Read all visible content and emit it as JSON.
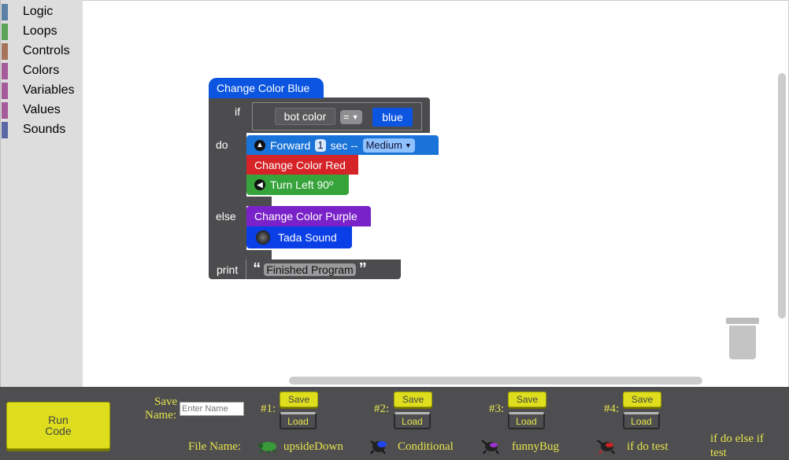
{
  "toolbox": {
    "categories": [
      {
        "label": "Logic",
        "color": "#5b80a5"
      },
      {
        "label": "Loops",
        "color": "#5ba55b"
      },
      {
        "label": "Controls",
        "color": "#a5745b"
      },
      {
        "label": "Colors",
        "color": "#a55b99"
      },
      {
        "label": "Variables",
        "color": "#a55b99"
      },
      {
        "label": "Values",
        "color": "#a55b99"
      },
      {
        "label": "Sounds",
        "color": "#5b67a5"
      }
    ]
  },
  "blocks": {
    "hat_label": "Change Color Blue",
    "if_label": "if",
    "bot_color_label": "bot color",
    "op_label": "=",
    "blue_label": "blue",
    "do_label": "do",
    "forward_label": "Forward",
    "forward_secs": "1",
    "sec_label": "sec --",
    "speed_label": "Medium",
    "change_red_label": "Change Color Red",
    "turn_left_label": "Turn Left 90º",
    "else_label": "else",
    "change_purple_label": "Change Color Purple",
    "tada_label": "Tada Sound",
    "print_label": "print",
    "open_quote": "“",
    "close_quote": "”",
    "print_text": "Finished Program"
  },
  "colors": {
    "event_blue": "#0b55e0",
    "motion_blue": "#1a73d9",
    "red": "#d62328",
    "green": "#36a33b",
    "purple": "#7a22c9",
    "sound_blue": "#0a3ee6",
    "logic_dark": "#4c4c4e",
    "accent_yellow": "#dede1e"
  },
  "bottom": {
    "run_label_1": "Run",
    "run_label_2": "Code",
    "save_name_label_1": "Save",
    "save_name_label_2": "Name:",
    "name_placeholder": "Enter Name",
    "slots": [
      {
        "num": "#1:",
        "save": "Save",
        "load": "Load"
      },
      {
        "num": "#2:",
        "save": "Save",
        "load": "Load"
      },
      {
        "num": "#3:",
        "save": "Save",
        "load": "Load"
      },
      {
        "num": "#4:",
        "save": "Save",
        "load": "Load"
      }
    ],
    "file_name_label": "File Name:",
    "files": [
      {
        "name": "upsideDown",
        "icon": "green-bug-icon"
      },
      {
        "name": "Conditional",
        "icon": "blue-bug-icon"
      },
      {
        "name": "funnyBug",
        "icon": "purple-bug-icon"
      },
      {
        "name": "if do test",
        "icon": "red-bug-icon"
      },
      {
        "name_1": "if do else if",
        "name_2": "test"
      }
    ]
  }
}
